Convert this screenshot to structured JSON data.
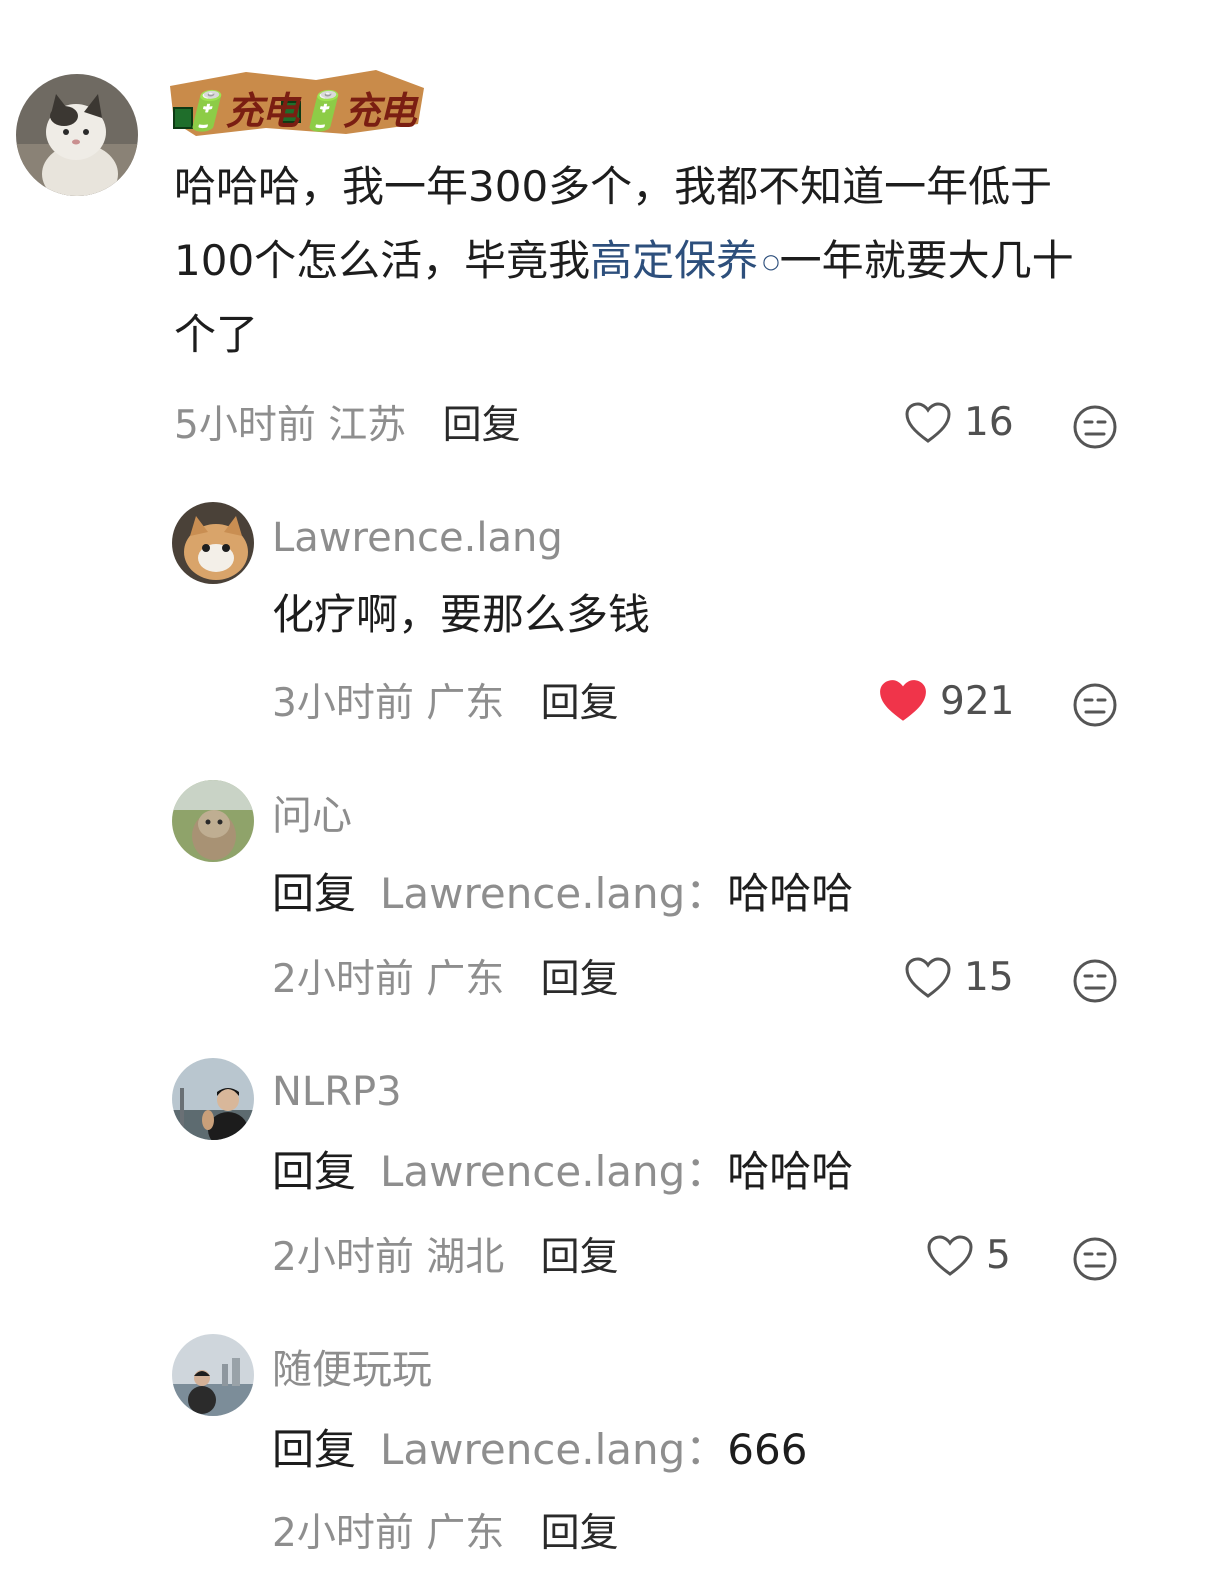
{
  "top_comment": {
    "username_badge": "🔋充电🔋充电",
    "text_before": "哈哈哈，我一年300多个，我都不知道一年低于100个怎么活，毕竟我",
    "link_text": "高定保养",
    "text_after": "一年就要大几十个了",
    "time": "5小时前",
    "location": "江苏",
    "reply_label": "回复",
    "likes": "16",
    "liked": false
  },
  "replies": [
    {
      "username": "Lawrence.lang",
      "text": "化疗啊，要那么多钱",
      "time": "3小时前",
      "location": "广东",
      "reply_label": "回复",
      "likes": "921",
      "liked": true
    },
    {
      "username": "问心",
      "reply_prefix": "回复",
      "reply_target": "Lawrence.lang：",
      "text": "哈哈哈",
      "time": "2小时前",
      "location": "广东",
      "reply_label": "回复",
      "likes": "15",
      "liked": false
    },
    {
      "username": "NLRP3",
      "reply_prefix": "回复",
      "reply_target": "Lawrence.lang：",
      "text": "哈哈哈",
      "time": "2小时前",
      "location": "湖北",
      "reply_label": "回复",
      "likes": "5",
      "liked": false
    },
    {
      "username": "随便玩玩",
      "reply_prefix": "回复",
      "reply_target": "Lawrence.lang：",
      "text": "666",
      "time": "2小时前",
      "location": "广东",
      "reply_label": "回复"
    }
  ],
  "colors": {
    "liked_heart": "#f0344a",
    "link": "#2d4f7c",
    "muted": "#8e8e8e",
    "badge_bg": "#c98b4a"
  },
  "icons": {
    "like": "heart-outline-icon",
    "liked": "heart-filled-icon",
    "dislike": "meh-face-icon",
    "link": "search-mini-icon"
  }
}
